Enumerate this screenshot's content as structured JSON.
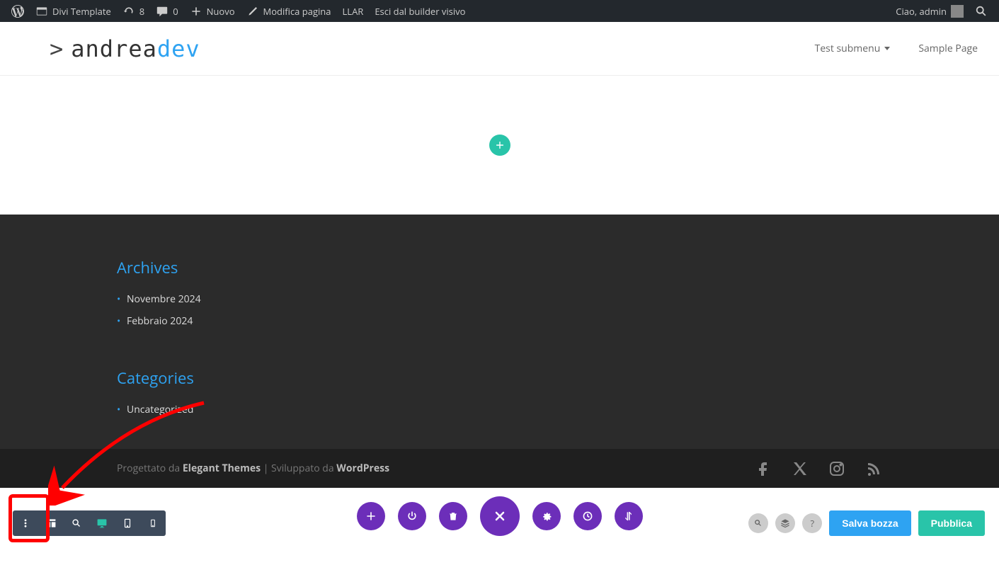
{
  "adminBar": {
    "siteName": "Divi Template",
    "updates": "8",
    "comments": "0",
    "newLabel": "Nuovo",
    "editPage": "Modifica pagina",
    "llar": "LLAR",
    "exitBuilder": "Esci dal builder visivo",
    "greeting": "Ciao, admin"
  },
  "header": {
    "logoPrompt": ">",
    "logoMain": "andrea",
    "logoAccent": "dev",
    "navItems": [
      {
        "label": "Test submenu",
        "hasDropdown": true
      },
      {
        "label": "Sample Page",
        "hasDropdown": false
      }
    ]
  },
  "footer": {
    "archivesTitle": "Archives",
    "archives": [
      "Novembre 2024",
      "Febbraio 2024"
    ],
    "categoriesTitle": "Categories",
    "categories": [
      "Uncategorized"
    ],
    "creditsPrefix": "Progettato da ",
    "creditsTheme": "Elegant Themes",
    "creditsMiddle": " | Sviluppato da ",
    "creditsPlatform": "WordPress"
  },
  "builder": {
    "saveDraft": "Salva bozza",
    "publish": "Pubblica"
  }
}
